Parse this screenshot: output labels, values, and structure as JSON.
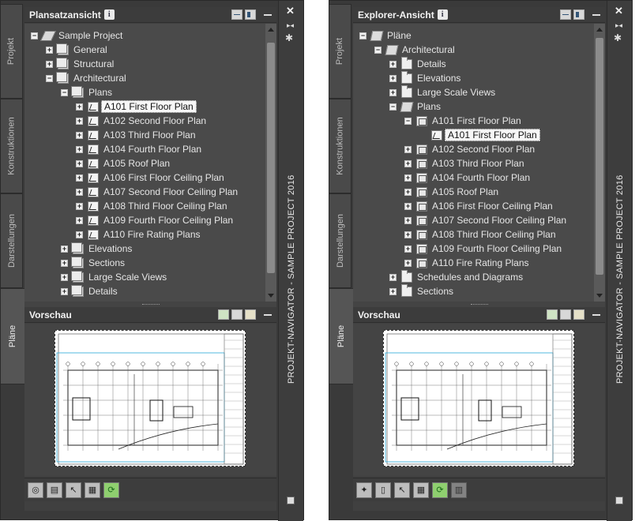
{
  "app_title": "PROJEKT-NAVIGATOR - SAMPLE PROJECT 2016",
  "tabs": [
    "Projekt",
    "Konstruktionen",
    "Darstellungen",
    "Pläne"
  ],
  "preview_title": "Vorschau",
  "left": {
    "title": "Plansatzansicht",
    "tree": [
      {
        "label": "Sample Project",
        "depth": 0,
        "exp": "-",
        "icon": "proj"
      },
      {
        "label": "General",
        "depth": 1,
        "exp": "+",
        "icon": "set"
      },
      {
        "label": "Structural",
        "depth": 1,
        "exp": "+",
        "icon": "set"
      },
      {
        "label": "Architectural",
        "depth": 1,
        "exp": "-",
        "icon": "set"
      },
      {
        "label": "Plans",
        "depth": 2,
        "exp": "-",
        "icon": "set"
      },
      {
        "label": "A101 First Floor Plan",
        "depth": 3,
        "exp": "+",
        "icon": "sheet",
        "selected": true
      },
      {
        "label": "A102 Second Floor Plan",
        "depth": 3,
        "exp": "+",
        "icon": "sheet"
      },
      {
        "label": "A103 Third Floor Plan",
        "depth": 3,
        "exp": "+",
        "icon": "sheet"
      },
      {
        "label": "A104 Fourth Floor Plan",
        "depth": 3,
        "exp": "+",
        "icon": "sheet"
      },
      {
        "label": "A105 Roof Plan",
        "depth": 3,
        "exp": "+",
        "icon": "sheet"
      },
      {
        "label": "A106 First Floor Ceiling Plan",
        "depth": 3,
        "exp": "+",
        "icon": "sheet"
      },
      {
        "label": "A107 Second Floor Ceiling Plan",
        "depth": 3,
        "exp": "+",
        "icon": "sheet"
      },
      {
        "label": "A108 Third Floor Ceiling Plan",
        "depth": 3,
        "exp": "+",
        "icon": "sheet"
      },
      {
        "label": "A109 Fourth Floor Ceiling Plan",
        "depth": 3,
        "exp": "+",
        "icon": "sheet"
      },
      {
        "label": "A110 Fire Rating Plans",
        "depth": 3,
        "exp": "+",
        "icon": "sheet"
      },
      {
        "label": "Elevations",
        "depth": 2,
        "exp": "+",
        "icon": "set"
      },
      {
        "label": "Sections",
        "depth": 2,
        "exp": "+",
        "icon": "set"
      },
      {
        "label": "Large Scale Views",
        "depth": 2,
        "exp": "+",
        "icon": "set"
      },
      {
        "label": "Details",
        "depth": 2,
        "exp": "+",
        "icon": "set"
      }
    ],
    "toolbar": [
      "globe-sync-icon",
      "sheet-list-icon",
      "select-pointer-icon",
      "grid-icon",
      "refresh-icon"
    ]
  },
  "right": {
    "title": "Explorer-Ansicht",
    "tree": [
      {
        "label": "Pläne",
        "depth": 0,
        "exp": "-",
        "icon": "open"
      },
      {
        "label": "Architectural",
        "depth": 1,
        "exp": "-",
        "icon": "open"
      },
      {
        "label": "Details",
        "depth": 2,
        "exp": "+",
        "icon": "folder"
      },
      {
        "label": "Elevations",
        "depth": 2,
        "exp": "+",
        "icon": "folder"
      },
      {
        "label": "Large Scale Views",
        "depth": 2,
        "exp": "+",
        "icon": "folder"
      },
      {
        "label": "Plans",
        "depth": 2,
        "exp": "-",
        "icon": "open"
      },
      {
        "label": "A101 First Floor Plan",
        "depth": 3,
        "exp": "-",
        "icon": "view"
      },
      {
        "label": "A101 First Floor Plan",
        "depth": 4,
        "exp": "",
        "icon": "sheet",
        "selected": true
      },
      {
        "label": "A102 Second Floor Plan",
        "depth": 3,
        "exp": "+",
        "icon": "view"
      },
      {
        "label": "A103 Third Floor Plan",
        "depth": 3,
        "exp": "+",
        "icon": "view"
      },
      {
        "label": "A104 Fourth Floor Plan",
        "depth": 3,
        "exp": "+",
        "icon": "view"
      },
      {
        "label": "A105 Roof Plan",
        "depth": 3,
        "exp": "+",
        "icon": "view"
      },
      {
        "label": "A106 First Floor Ceiling Plan",
        "depth": 3,
        "exp": "+",
        "icon": "view"
      },
      {
        "label": "A107 Second Floor Ceiling Plan",
        "depth": 3,
        "exp": "+",
        "icon": "view"
      },
      {
        "label": "A108 Third Floor Ceiling Plan",
        "depth": 3,
        "exp": "+",
        "icon": "view"
      },
      {
        "label": "A109 Fourth Floor Ceiling Plan",
        "depth": 3,
        "exp": "+",
        "icon": "view"
      },
      {
        "label": "A110 Fire Rating Plans",
        "depth": 3,
        "exp": "+",
        "icon": "view"
      },
      {
        "label": "Schedules and Diagrams",
        "depth": 2,
        "exp": "+",
        "icon": "folder"
      },
      {
        "label": "Sections",
        "depth": 2,
        "exp": "+",
        "icon": "folder"
      }
    ],
    "toolbar": [
      "new-sheet-icon",
      "clipboard-icon",
      "select-pointer-icon",
      "grid-icon",
      "refresh-icon",
      "disabled-tool-icon"
    ]
  }
}
